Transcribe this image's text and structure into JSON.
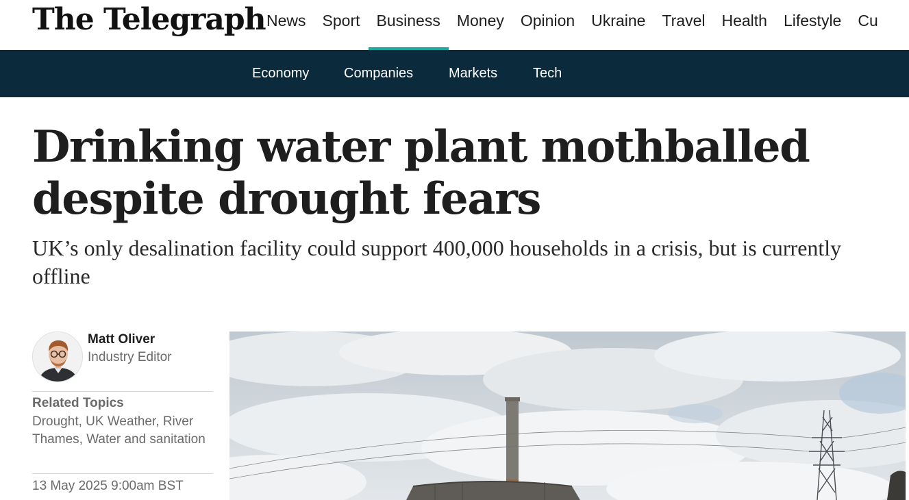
{
  "header": {
    "logo_text": "The Telegraph",
    "nav": [
      {
        "label": "News",
        "active": false
      },
      {
        "label": "Sport",
        "active": false
      },
      {
        "label": "Business",
        "active": true
      },
      {
        "label": "Money",
        "active": false
      },
      {
        "label": "Opinion",
        "active": false
      },
      {
        "label": "Ukraine",
        "active": false
      },
      {
        "label": "Travel",
        "active": false
      },
      {
        "label": "Health",
        "active": false
      },
      {
        "label": "Lifestyle",
        "active": false
      },
      {
        "label": "Cu",
        "active": false
      }
    ],
    "active_color": "#1aa8a0"
  },
  "subnav": {
    "background": "#0b2a3b",
    "items": [
      "Economy",
      "Companies",
      "Markets",
      "Tech"
    ]
  },
  "article": {
    "headline": "Drinking water plant mothballed despite drought fears",
    "standfirst": "UK’s only desalination facility could support 400,000 households in a crisis, but is currently offline",
    "author": {
      "name": "Matt Oliver",
      "role": "Industry Editor"
    },
    "related": {
      "title": "Related Topics",
      "topics": [
        "Drought",
        "UK Weather",
        "River Thames",
        "Water and sanitation"
      ]
    },
    "date": "13 May 2025 9:00am BST"
  },
  "icons": {
    "author_avatar": "author-photo",
    "hero_image": "desalination-plant-photo"
  }
}
